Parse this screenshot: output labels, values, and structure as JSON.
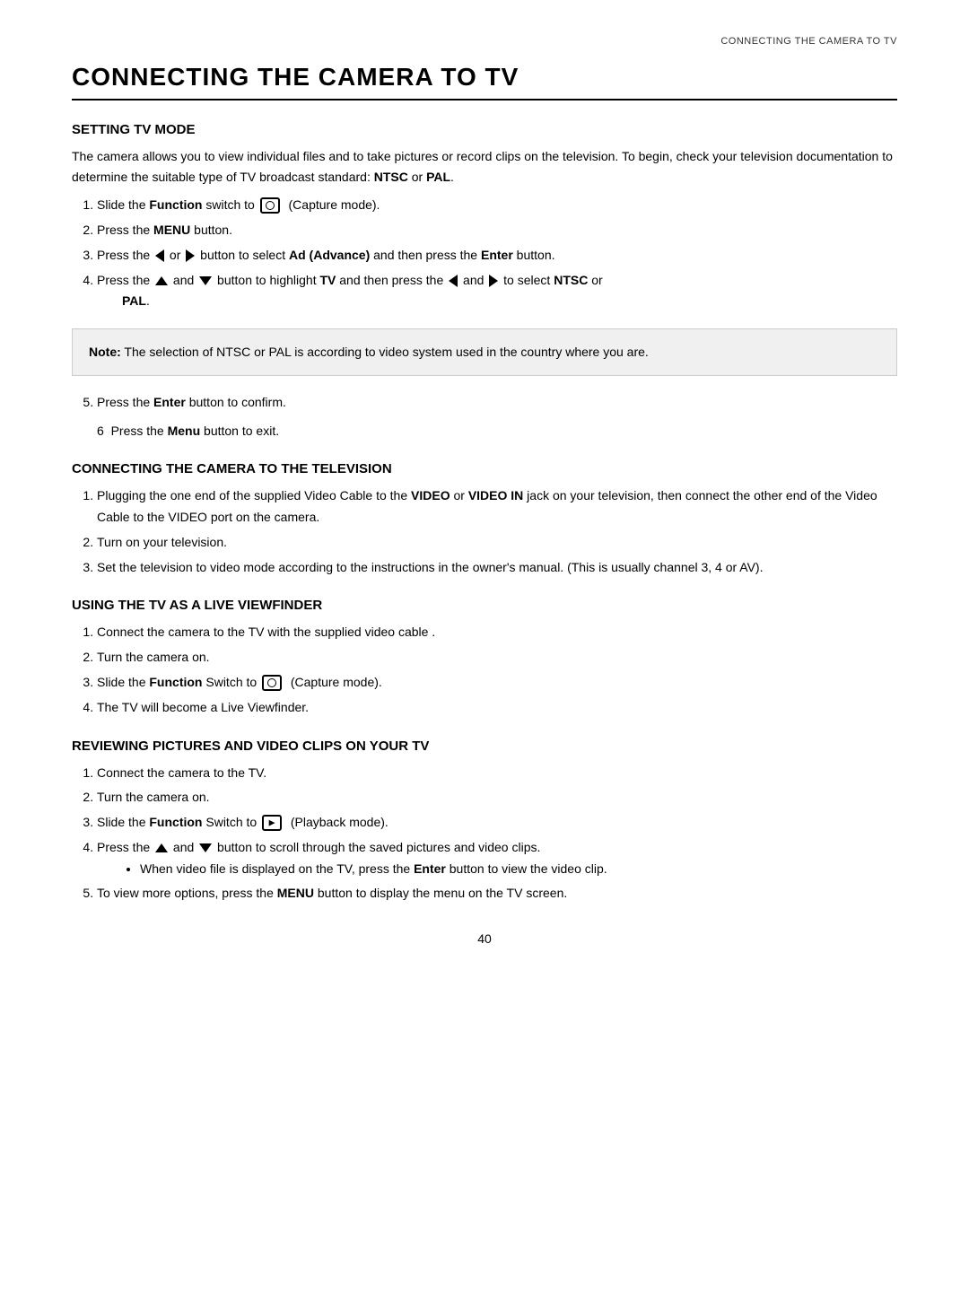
{
  "page": {
    "header": "CONNECTING THE CAMERA TO TV",
    "main_title": "CONNECTING THE CAMERA TO TV",
    "page_number": "40",
    "sections": [
      {
        "id": "setting_tv_mode",
        "title": "SETTING TV MODE",
        "intro": "The camera allows you to view individual files and to take pictures or record clips on the television. To begin, check your television documentation to determine the suitable type of TV broadcast standard: NTSC or PAL.",
        "steps": [
          "Slide the <b>Function</b> switch to [capture] (Capture mode).",
          "Press the <b>MENU</b> button.",
          "Press the [left] or [right] button to select <b>Ad (Advance)</b> and then press the <b>Enter</b> button.",
          "Press the [up] and [down] button to highlight <b>TV</b> and then press the [left] and [right] to select <b>NTSC</b> or <b>PAL</b>."
        ],
        "note": "<b>Note:</b> The selection of NTSC or PAL is according to video system used in the country where you are.",
        "steps2": [
          "Press the <b>Enter</b> button to confirm.",
          "Press the <b>Menu</b> button to exit."
        ]
      },
      {
        "id": "connecting_camera_television",
        "title": "CONNECTING THE CAMERA TO THE TELEVISION",
        "steps": [
          "Plugging the one end of the supplied Video Cable to the <b>VIDEO</b> or <b>VIDEO IN</b> jack on your television, then connect the other end of the Video Cable to the VIDEO port on the camera.",
          "Turn on your television.",
          "Set the television to video mode according to the instructions in the owner’s manual. (This is usually channel 3, 4 or AV)."
        ]
      },
      {
        "id": "using_tv_live_viewfinder",
        "title": "USING THE TV AS A LIVE VIEWFINDER",
        "steps": [
          "Connect the camera to the TV with the supplied video cable .",
          "Turn the camera on.",
          "Slide the <b>Function</b> Switch to [capture] (Capture mode).",
          "The TV will become a Live Viewfinder."
        ]
      },
      {
        "id": "reviewing_pictures",
        "title": "REVIEWING PICTURES AND VIDEO CLIPS ON YOUR TV",
        "steps": [
          "Connect the camera to the TV.",
          "Turn the camera on.",
          "Slide the <b>Function</b> Switch to [playback] (Playback mode).",
          "Press the [up] and [down] button to scroll through the saved pictures and video clips.",
          "To view more options, press the <b>MENU</b> button to display the menu on the TV screen."
        ],
        "substep4": "When video file is displayed on the TV, press the <b>Enter</b> button to view the video clip."
      }
    ]
  }
}
